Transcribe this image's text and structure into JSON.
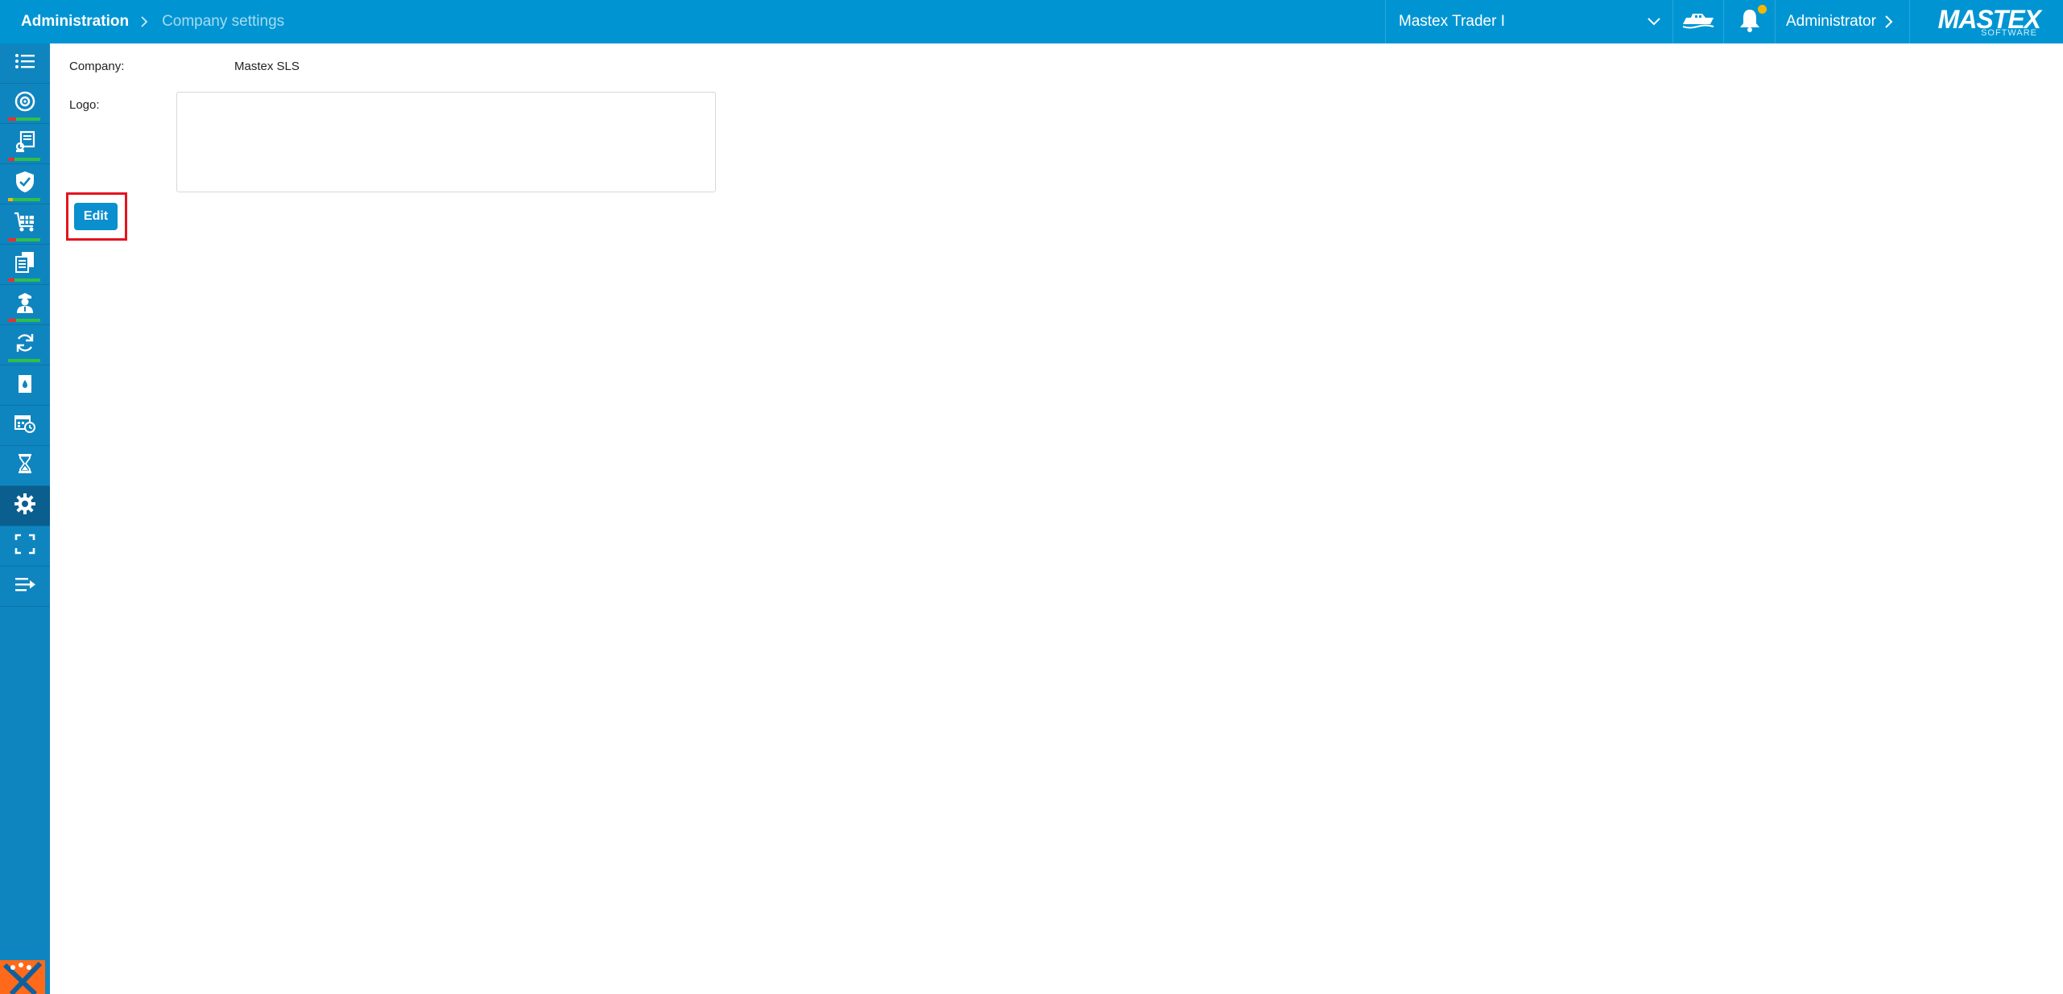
{
  "breadcrumb": {
    "root": "Administration",
    "current": "Company settings"
  },
  "header": {
    "vessel": "Mastex Trader I",
    "user": "Administrator",
    "logo_word": "MASTEX",
    "logo_sub": "SOFTWARE",
    "notification_dot_color": "#f5b800"
  },
  "sidebar": {
    "items": [
      {
        "icon": "list-icon"
      },
      {
        "icon": "gauge-icon"
      },
      {
        "icon": "documents-icon"
      },
      {
        "icon": "shield-check-icon"
      },
      {
        "icon": "cart-icon"
      },
      {
        "icon": "papers-icon"
      },
      {
        "icon": "crew-icon"
      },
      {
        "icon": "sync-icon"
      },
      {
        "icon": "oil-can-icon"
      },
      {
        "icon": "calendar-clock-icon"
      },
      {
        "icon": "hourglass-icon"
      },
      {
        "icon": "settings-gear-icon",
        "active": true
      },
      {
        "icon": "fullscreen-icon"
      },
      {
        "icon": "collapse-menu-icon"
      }
    ]
  },
  "form": {
    "company_label": "Company:",
    "company_value": "Mastex SLS",
    "logo_label": "Logo:",
    "edit_label": "Edit"
  },
  "colors": {
    "topbar": "#0095d2",
    "sidebar": "#0f85bf",
    "sidebar_active": "#0a5f8f",
    "button": "#0a8fcf",
    "highlight": "#e3141e"
  }
}
